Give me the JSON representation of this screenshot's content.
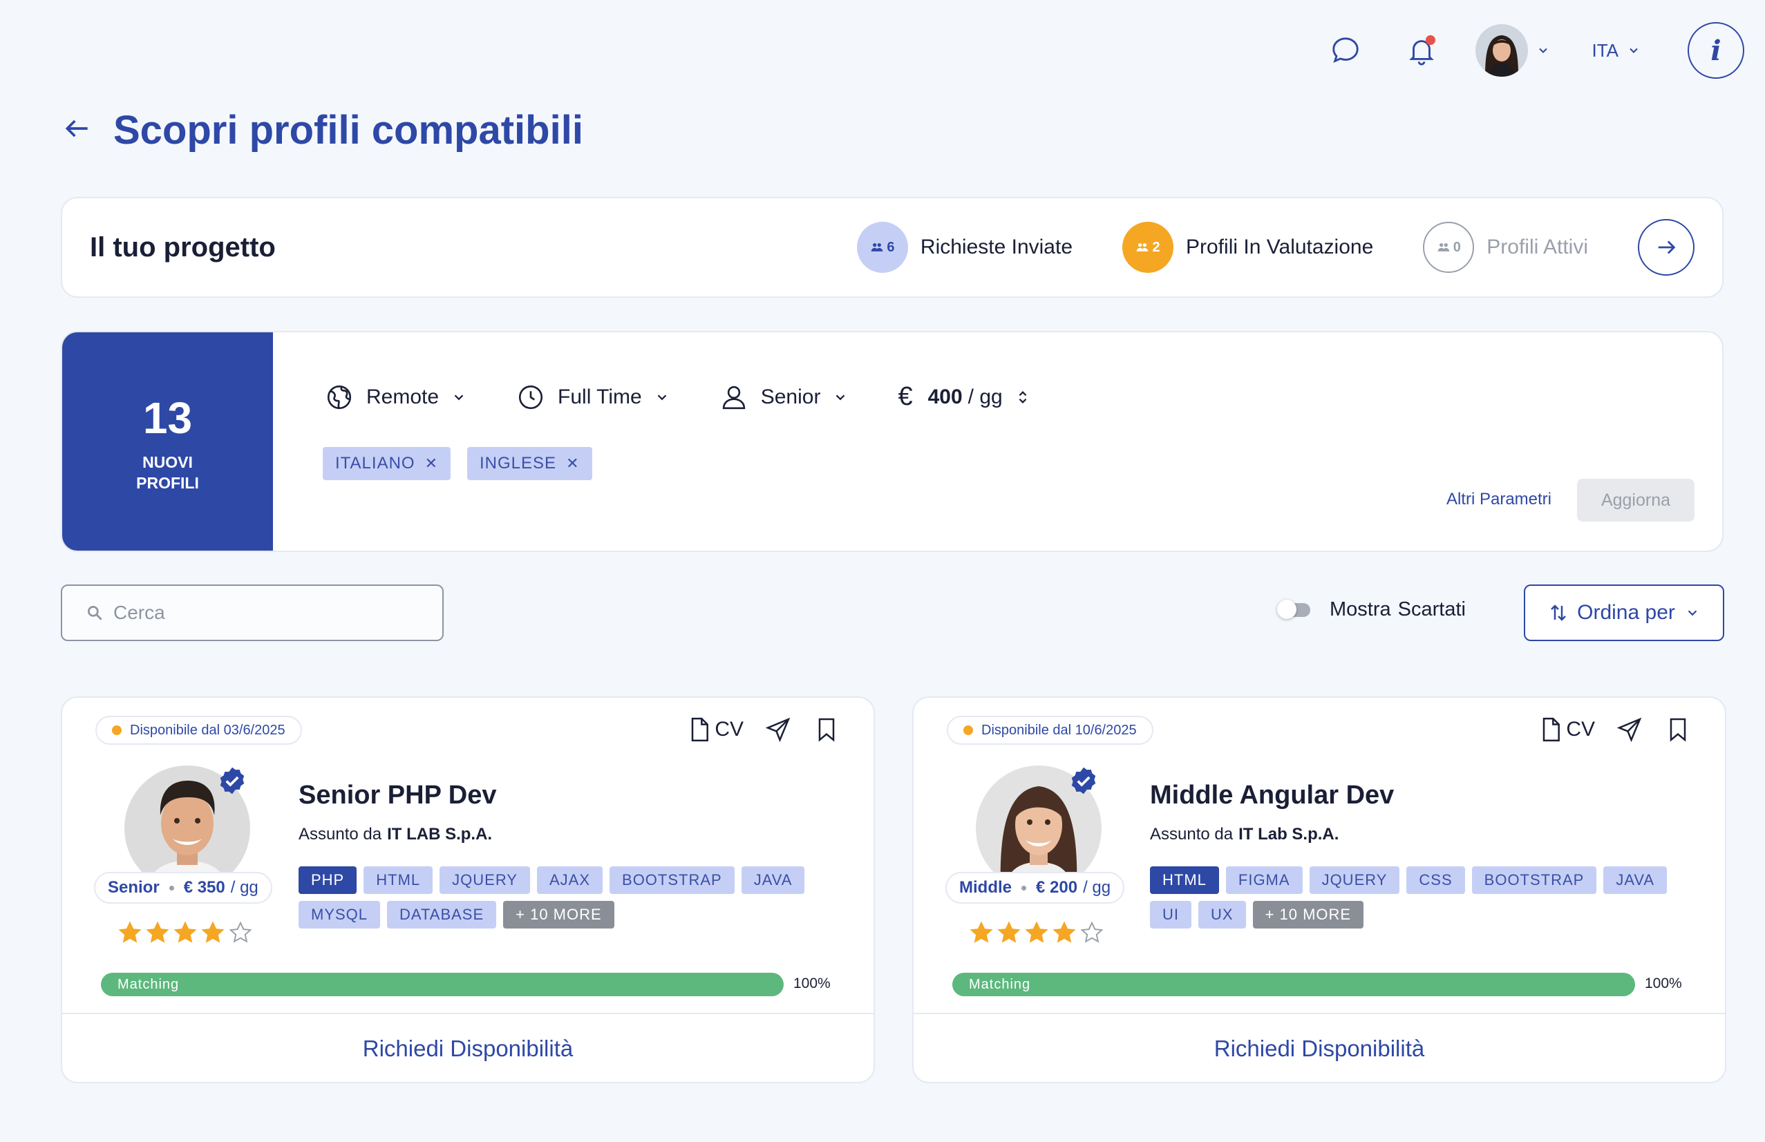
{
  "header": {
    "icons": [
      "chat-icon",
      "bell-icon"
    ],
    "language": "ITA",
    "info_symbol": "i"
  },
  "page": {
    "title": "Scopri profili compatibili"
  },
  "project": {
    "title": "Il tuo progetto",
    "stats": [
      {
        "count": "6",
        "label": "Richieste Inviate",
        "circle_color": "#c5cff5",
        "text_color": "#2e48a6",
        "label_color": "#1a1f36"
      },
      {
        "count": "2",
        "label": "Profili In Valutazione",
        "circle_color": "#f5a623",
        "text_color": "#ffffff",
        "label_color": "#1a1f36"
      },
      {
        "count": "0",
        "label": "Profili Attivi",
        "circle_color": "#ffffff",
        "text_color": "#9aa0aa",
        "label_color": "#9aa0aa"
      }
    ]
  },
  "filters": {
    "new_count": "13",
    "new_label": "NUOVI\nPROFILI",
    "work_mode": "Remote",
    "schedule": "Full Time",
    "seniority": "Senior",
    "currency": "€",
    "rate": "400",
    "rate_unit": "/ gg",
    "languages": [
      "ITALIANO",
      "INGLESE"
    ],
    "more_params": "Altri Parametri",
    "update_button": "Aggiorna"
  },
  "search": {
    "placeholder": "Cerca"
  },
  "toggle": {
    "label_1": "Mostra",
    "label_2": "Scartati",
    "on": false
  },
  "sort": {
    "label": "Ordina per"
  },
  "profiles": [
    {
      "availability": "Disponibile dal 03/6/2025",
      "cv_label": "CV",
      "role": "Senior PHP Dev",
      "hired_by_label": "Assunto da",
      "company": "IT LAB S.p.A.",
      "level": "Senior",
      "rate": "€ 350",
      "rate_unit": "/ gg",
      "rating": 4,
      "rating_max": 5,
      "skills": [
        "PHP",
        "HTML",
        "JQUERY",
        "AJAX",
        "BOOTSTRAP",
        "JAVA",
        "MYSQL",
        "DATABASE"
      ],
      "active_skill": "PHP",
      "more_skills": "+ 10 MORE",
      "matching_label": "Matching",
      "matching_percent": "100%",
      "matching_value": 1.0,
      "cta": "Richiedi Disponibilità"
    },
    {
      "availability": "Disponibile dal 10/6/2025",
      "cv_label": "CV",
      "role": "Middle Angular Dev",
      "hired_by_label": "Assunto da",
      "company": "IT Lab S.p.A.",
      "level": "Middle",
      "rate": "€ 200",
      "rate_unit": "/ gg",
      "rating": 4,
      "rating_max": 5,
      "skills": [
        "HTML",
        "FIGMA",
        "JQUERY",
        "CSS",
        "BOOTSTRAP",
        "JAVA",
        "UI",
        "UX"
      ],
      "active_skill": "HTML",
      "more_skills": "+ 10 MORE",
      "matching_label": "Matching",
      "matching_percent": "100%",
      "matching_value": 1.0,
      "cta": "Richiedi Disponibilità"
    }
  ],
  "colors": {
    "primary": "#2e48a6",
    "accent": "#f5a623",
    "match": "#5cb87d",
    "tag": "#c5cff5"
  }
}
